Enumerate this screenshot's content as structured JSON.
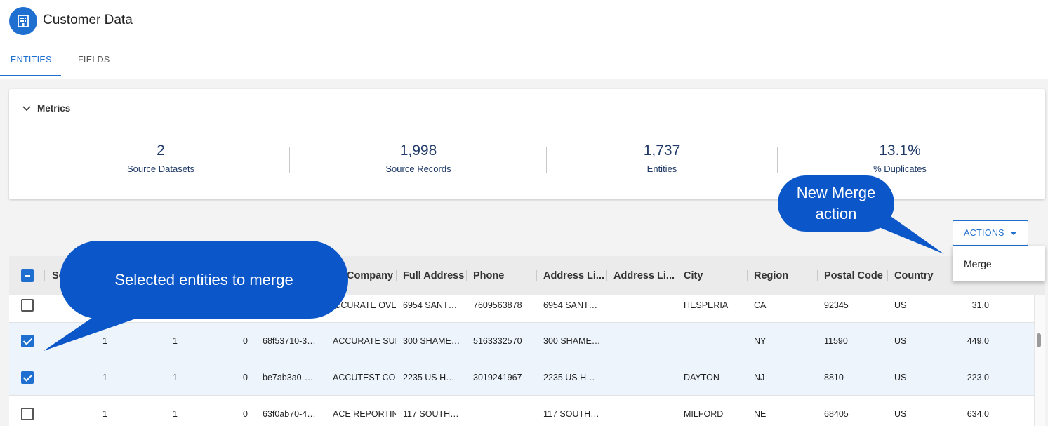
{
  "app": {
    "title": "Customer Data",
    "logo_icon": "building-icon"
  },
  "tabs": [
    {
      "label": "ENTITIES",
      "active": true
    },
    {
      "label": "FIELDS",
      "active": false
    }
  ],
  "metrics": {
    "title": "Metrics",
    "items": [
      {
        "value": "2",
        "label": "Source Datasets"
      },
      {
        "value": "1,998",
        "label": "Source Records"
      },
      {
        "value": "1,737",
        "label": "Entities"
      },
      {
        "value": "13.1%",
        "label": "% Duplicates"
      }
    ]
  },
  "actions": {
    "button_label": "ACTIONS",
    "menu_items": [
      "Merge"
    ]
  },
  "table": {
    "header_checkbox": "indeterminate",
    "columns": [
      "So",
      "Company ...",
      "Full Address",
      "Phone",
      "Address Li...",
      "Address Li...",
      "City",
      "Region",
      "Postal Code",
      "Country"
    ],
    "rows": [
      {
        "checked": false,
        "c1": "",
        "c2": "",
        "c3": "",
        "id": "",
        "company": "ACCURATE OVEI",
        "full_address": "6954 SANT…",
        "phone": "7609563878",
        "address1": "6954 SANT…",
        "address2": "",
        "city": "HESPERIA",
        "region": "CA",
        "postal": "92345",
        "country": "US",
        "value": "31.0"
      },
      {
        "checked": true,
        "c1": "1",
        "c2": "1",
        "c3": "0",
        "id": "68f53710-3…",
        "company": "ACCURATE SURI",
        "full_address": "300 SHAME…",
        "phone": "5163332570",
        "address1": "300 SHAME…",
        "address2": "",
        "city": "",
        "region": "NY",
        "postal": "11590",
        "country": "US",
        "value": "449.0"
      },
      {
        "checked": true,
        "c1": "1",
        "c2": "1",
        "c3": "0",
        "id": "be7ab3a0-…",
        "company": "ACCUTEST COR",
        "full_address": "2235 US H…",
        "phone": "3019241967",
        "address1": "2235 US H…",
        "address2": "",
        "city": "DAYTON",
        "region": "NJ",
        "postal": "8810",
        "country": "US",
        "value": "223.0"
      },
      {
        "checked": false,
        "c1": "1",
        "c2": "1",
        "c3": "0",
        "id": "63f0ab70-4…",
        "company": "ACE REPORTINC",
        "full_address": "117 SOUTH…",
        "phone": "",
        "address1": "117 SOUTH…",
        "address2": "",
        "city": "MILFORD",
        "region": "NE",
        "postal": "68405",
        "country": "US",
        "value": "634.0"
      }
    ]
  },
  "callouts": {
    "merge": "New Merge action",
    "selected": "Selected entities to merge"
  },
  "colors": {
    "accent": "#1e6fd0",
    "callout": "#0b57c9",
    "metric_text": "#1f3a68"
  }
}
